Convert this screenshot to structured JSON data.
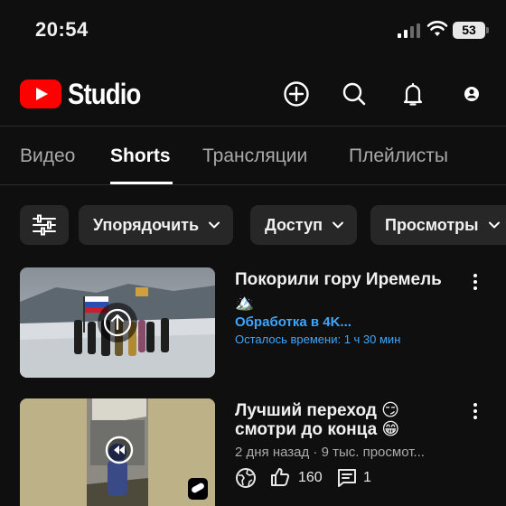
{
  "status_bar": {
    "time": "20:54",
    "battery": "53"
  },
  "header": {
    "logo_text": "Studio"
  },
  "tabs": [
    {
      "label": "Видео"
    },
    {
      "label": "Shorts"
    },
    {
      "label": "Трансляции"
    },
    {
      "label": "Плейлисты"
    }
  ],
  "filters": [
    {
      "label": "Упорядочить"
    },
    {
      "label": "Доступ"
    },
    {
      "label": "Просмотры"
    }
  ],
  "videos": [
    {
      "title_line1": "Покорили гору Иремель",
      "title_line2": "🏔️",
      "processing": "Обработка в 4K...",
      "remaining": "Осталось времени: 1 ч 30 мин"
    },
    {
      "title_line1": "Лучший переход 😏",
      "title_line2": "смотри до конца 😁",
      "meta": "2 дня назад · 9 тыс. просмот...",
      "likes": "160",
      "comments": "1"
    }
  ],
  "colors": {
    "brand": "#ff0000",
    "accent": "#3ea6ff",
    "background": "#0f0f0f",
    "chip": "#272727"
  }
}
